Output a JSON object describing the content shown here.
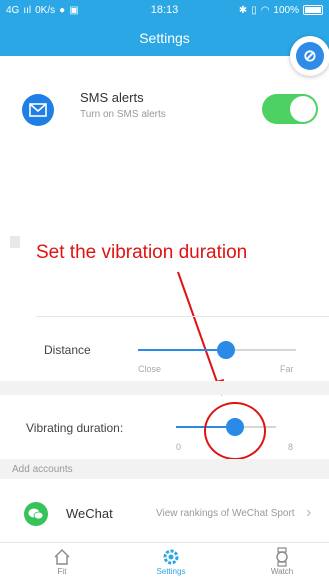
{
  "status_bar": {
    "network": "4G",
    "speed": "0K/s",
    "time": "18:13",
    "battery": "100%"
  },
  "header": {
    "title": "Settings"
  },
  "sms": {
    "title": "SMS alerts",
    "subtitle": "Turn on SMS alerts",
    "enabled": true
  },
  "annotation": {
    "text": "Set the vibration duration",
    "color": "#e01212"
  },
  "distance": {
    "label": "Distance",
    "min_label": "Close",
    "max_label": "Far",
    "value": 0.56
  },
  "vibration": {
    "label": "Vibrating duration:",
    "min_label": "0",
    "max_label": "8",
    "value": 0.59
  },
  "accounts": {
    "header": "Add accounts",
    "wechat_name": "WeChat",
    "wechat_link": "View rankings of WeChat Sport"
  },
  "tabs": [
    {
      "label": "Fit",
      "icon": "home-icon",
      "active": false
    },
    {
      "label": "Settings",
      "icon": "gear-icon",
      "active": true
    },
    {
      "label": "Watch",
      "icon": "watch-icon",
      "active": false
    }
  ],
  "colors": {
    "primary": "#2aa7e4",
    "toggle_on": "#4ed163",
    "slider": "#2b8ae6",
    "annotation": "#e01212"
  }
}
